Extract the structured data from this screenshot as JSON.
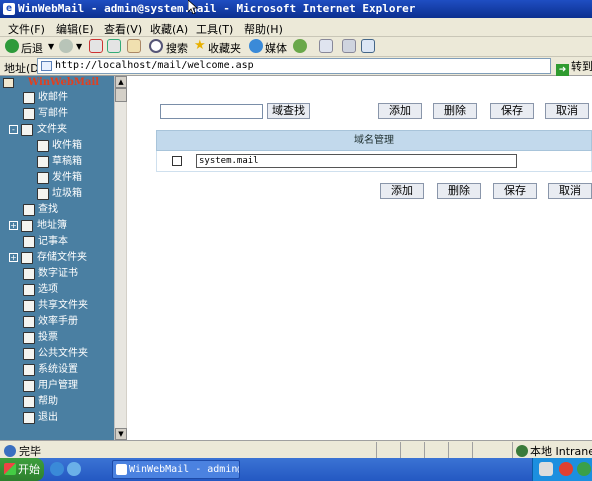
{
  "window": {
    "title": "WinWebMail - admin@system.mail - Microsoft Internet Explorer"
  },
  "menu": [
    "文件(F)",
    "编辑(E)",
    "查看(V)",
    "收藏(A)",
    "工具(T)",
    "帮助(H)"
  ],
  "toolbar": {
    "back": "后退",
    "search": "搜索",
    "favorites": "收藏夹",
    "media": "媒体"
  },
  "address": {
    "label": "地址(D)",
    "url": "http://localhost/mail/welcome.asp",
    "go": "转到"
  },
  "sidebar": {
    "header": "WinWebMail",
    "items": [
      {
        "label": "收邮件",
        "depth": 1,
        "expander": ""
      },
      {
        "label": "写邮件",
        "depth": 1,
        "expander": ""
      },
      {
        "label": "文件夹",
        "depth": 0,
        "expander": "-"
      },
      {
        "label": "收件箱",
        "depth": 2,
        "expander": ""
      },
      {
        "label": "草稿箱",
        "depth": 2,
        "expander": ""
      },
      {
        "label": "发件箱",
        "depth": 2,
        "expander": ""
      },
      {
        "label": "垃圾箱",
        "depth": 2,
        "expander": ""
      },
      {
        "label": "查找",
        "depth": 1,
        "expander": ""
      },
      {
        "label": "地址簿",
        "depth": 0,
        "expander": "+"
      },
      {
        "label": "记事本",
        "depth": 1,
        "expander": ""
      },
      {
        "label": "存储文件夹",
        "depth": 0,
        "expander": "+"
      },
      {
        "label": "数字证书",
        "depth": 1,
        "expander": ""
      },
      {
        "label": "选项",
        "depth": 1,
        "expander": ""
      },
      {
        "label": "共享文件夹",
        "depth": 1,
        "expander": ""
      },
      {
        "label": "效率手册",
        "depth": 1,
        "expander": ""
      },
      {
        "label": "投票",
        "depth": 1,
        "expander": ""
      },
      {
        "label": "公共文件夹",
        "depth": 1,
        "expander": ""
      },
      {
        "label": "系统设置",
        "depth": 1,
        "expander": ""
      },
      {
        "label": "用户管理",
        "depth": 1,
        "expander": ""
      },
      {
        "label": "帮助",
        "depth": 1,
        "expander": ""
      },
      {
        "label": "退出",
        "depth": 1,
        "expander": ""
      }
    ]
  },
  "main": {
    "search_value": "",
    "search_button": "域查找",
    "buttons": {
      "add": "添加",
      "delete": "删除",
      "save": "保存",
      "cancel": "取消"
    },
    "table_header": "域名管理",
    "rows": [
      {
        "domain": "system.mail",
        "checked": false
      }
    ]
  },
  "status": {
    "left": "完毕",
    "zone": "本地 Intranet"
  },
  "taskbar": {
    "start": "开始",
    "item": "WinWebMail - admin@..."
  },
  "colors": {
    "sidebar": "#4a7fa2",
    "table_header": "#c2d9ec",
    "titlebar": "#0b2f8f"
  }
}
